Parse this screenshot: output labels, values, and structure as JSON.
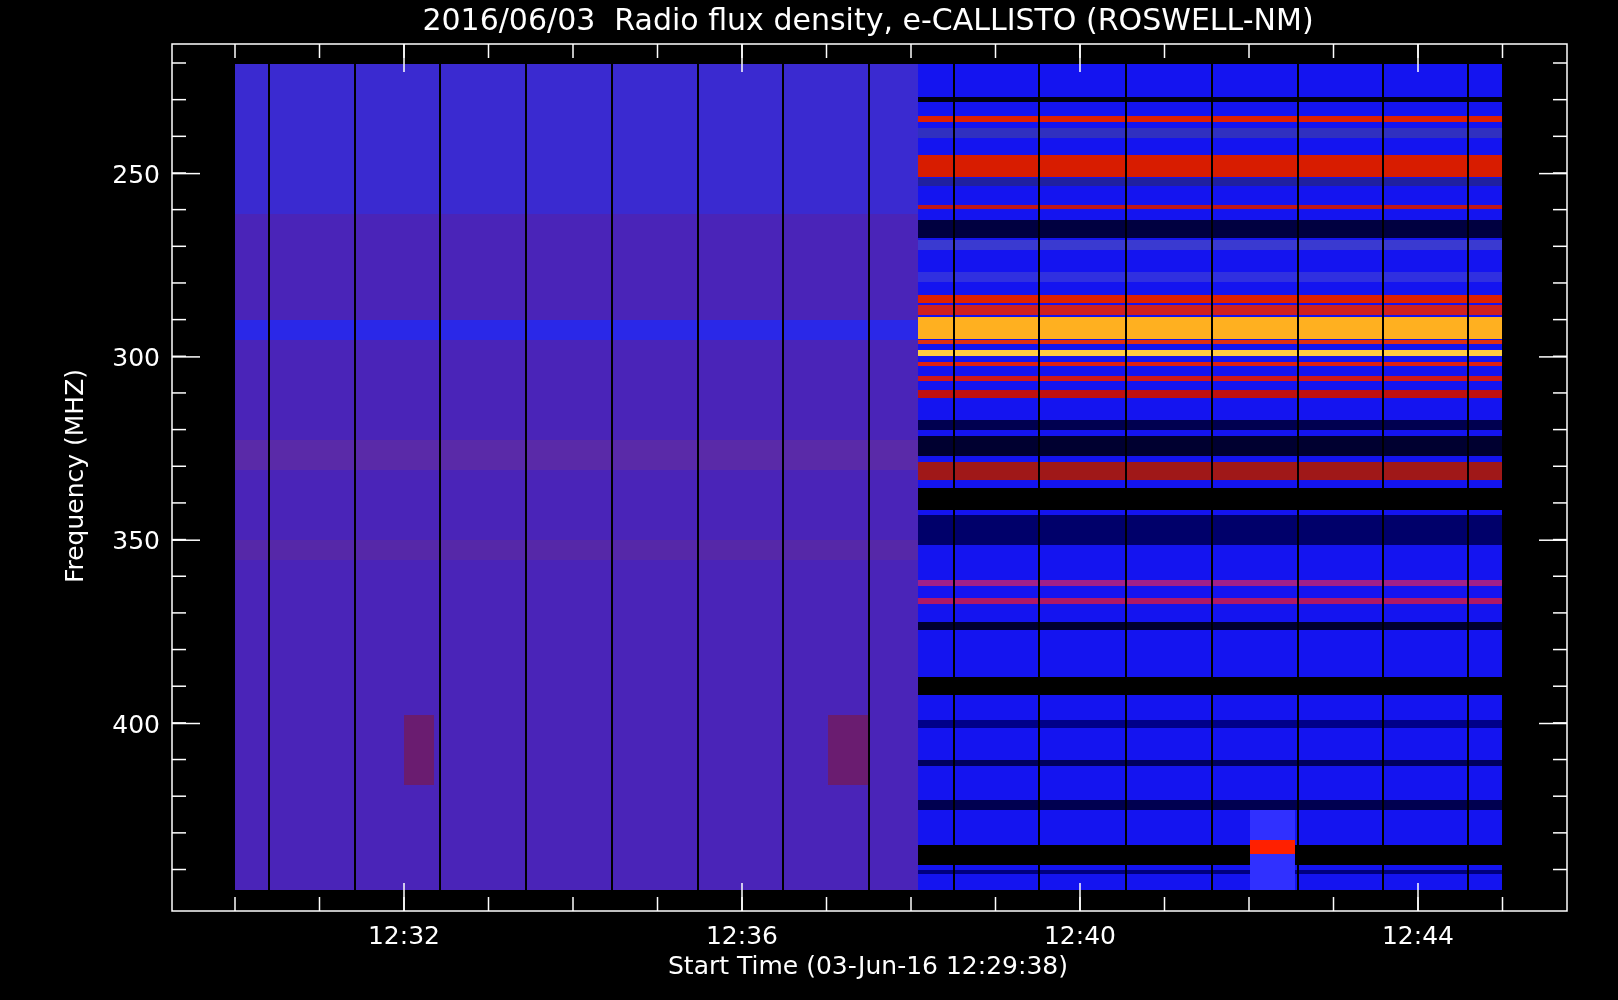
{
  "plot": {
    "title": "2016/06/03  Radio flux density, e-CALLISTO (ROSWELL-NM)",
    "ylabel": "Frequency (MHZ)",
    "xlabel": "Start Time (03-Jun-16 12:29:38)",
    "yticks": [
      "250",
      "300",
      "350",
      "400"
    ],
    "xticks": [
      "12:32",
      "12:36",
      "12:40",
      "12:44"
    ]
  }
}
